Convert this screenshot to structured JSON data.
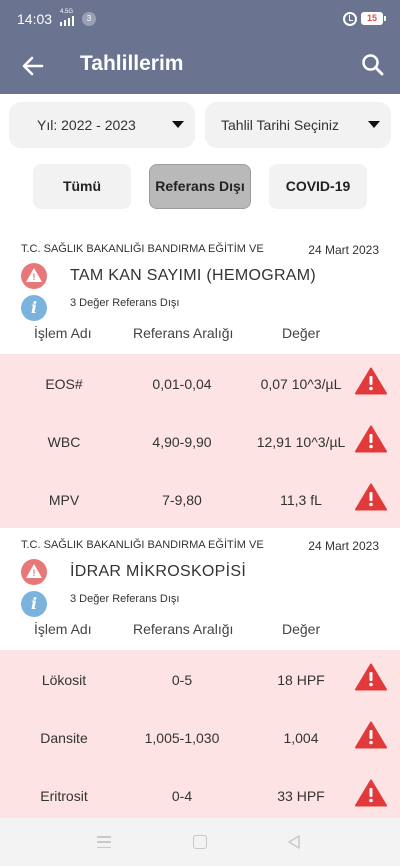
{
  "status_bar": {
    "time": "14:03",
    "network": "4.5G",
    "notification_count": "3",
    "battery": "15"
  },
  "header": {
    "title": "Tahlillerim"
  },
  "filters": {
    "year": "Yıl: 2022 - 2023",
    "date": "Tahlil Tarihi Seçiniz"
  },
  "tabs": {
    "all": "Tümü",
    "out_of_reference": "Referans Dışı",
    "covid": "COVID-19",
    "selected": "Referans Dışı"
  },
  "columns": {
    "name": "İşlem Adı",
    "range": "Referans Aralığı",
    "value": "Değer"
  },
  "groups": [
    {
      "institution": "T.C. SAĞLIK BAKANLIĞI BANDIRMA EĞİTİM VE",
      "date": "24 Mart 2023",
      "test_name": "TAM KAN SAYIMI (HEMOGRAM)",
      "summary": "3 Değer Referans Dışı",
      "rows": [
        {
          "name": "EOS#",
          "range": "0,01-0,04",
          "value": "0,07 10^3/µL"
        },
        {
          "name": "WBC",
          "range": "4,90-9,90",
          "value": "12,91 10^3/µL"
        },
        {
          "name": "MPV",
          "range": "7-9,80",
          "value": "11,3 fL"
        }
      ]
    },
    {
      "institution": "T.C. SAĞLIK BAKANLIĞI BANDIRMA EĞİTİM VE",
      "date": "24 Mart 2023",
      "test_name": "İDRAR MİKROSKOPİSİ",
      "summary": "3 Değer Referans Dışı",
      "rows": [
        {
          "name": "Lökosit",
          "range": "0-5",
          "value": "18 HPF"
        },
        {
          "name": "Dansite",
          "range": "1,005-1,030",
          "value": "1,004"
        },
        {
          "name": "Eritrosit",
          "range": "0-4",
          "value": "33 HPF"
        }
      ]
    }
  ],
  "colors": {
    "header": "#6a7491",
    "warning": "#e23a3a",
    "out_of_range_row": "#fde3e3",
    "info": "#7ab3de"
  },
  "icons": {
    "back": "arrow-left-icon",
    "search": "search-icon",
    "warning": "warning-triangle-icon",
    "info": "info-icon"
  }
}
